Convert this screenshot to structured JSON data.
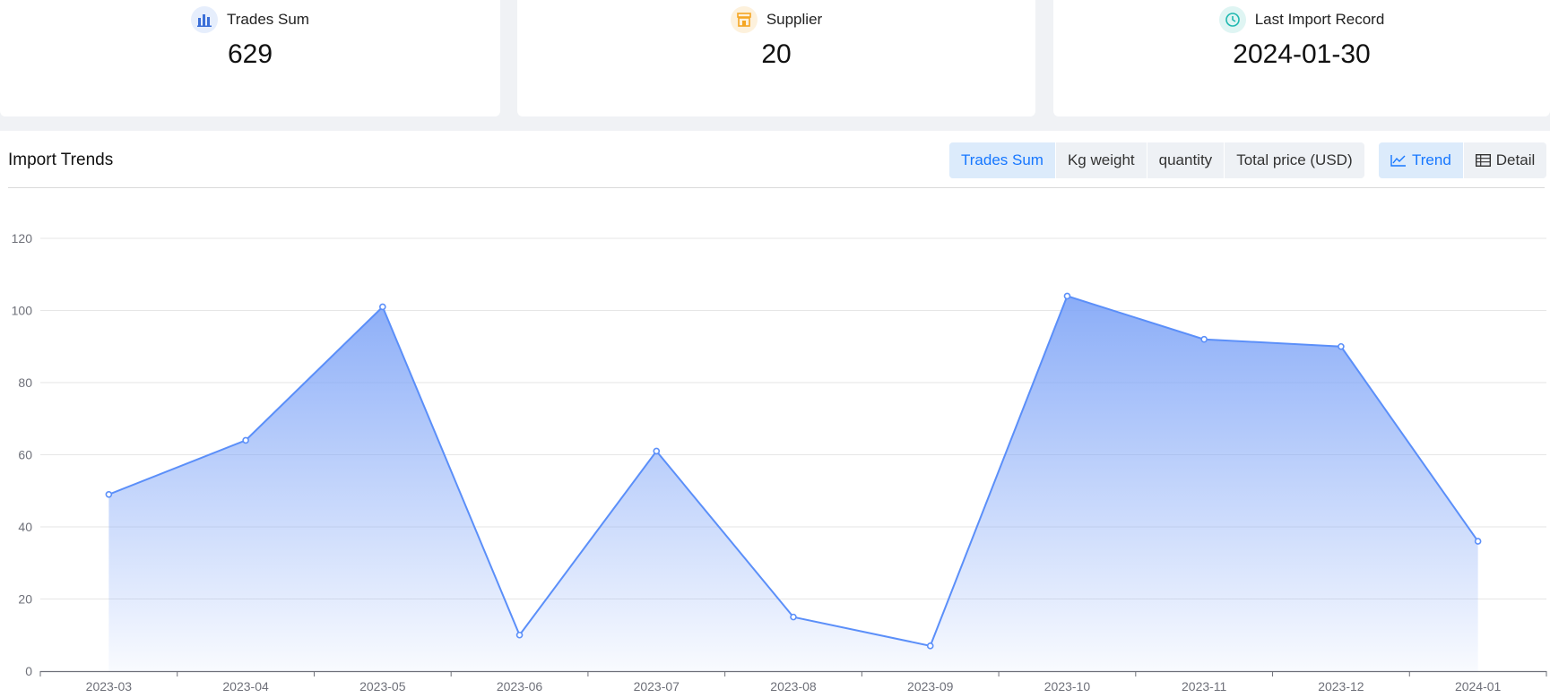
{
  "summary": {
    "trades": {
      "label": "Trades Sum",
      "value": "629",
      "icon": "bar-chart-icon",
      "color": "#3b6fd8"
    },
    "supplier": {
      "label": "Supplier",
      "value": "20",
      "icon": "store-icon",
      "color": "#f5a623"
    },
    "last_import": {
      "label": "Last Import Record",
      "value": "2024-01-30",
      "icon": "clock-icon",
      "color": "#1fb8b0"
    }
  },
  "panel": {
    "title": "Import Trends",
    "metric_tabs": [
      "Trades Sum",
      "Kg weight",
      "quantity",
      "Total price (USD)"
    ],
    "active_metric": "Trades Sum",
    "view_tabs": [
      {
        "label": "Trend",
        "icon": "line-chart-icon"
      },
      {
        "label": "Detail",
        "icon": "table-icon"
      }
    ],
    "active_view": "Trend"
  },
  "colors": {
    "accent": "#1677ff",
    "line": "#5b8ff9",
    "area_top": "#7ea4f7"
  },
  "chart_data": {
    "type": "area",
    "categories": [
      "2023-03",
      "2023-04",
      "2023-05",
      "2023-06",
      "2023-07",
      "2023-08",
      "2023-09",
      "2023-10",
      "2023-11",
      "2023-12",
      "2024-01"
    ],
    "values": [
      49,
      64,
      101,
      10,
      61,
      15,
      7,
      104,
      92,
      90,
      36
    ],
    "ylim": [
      0,
      120
    ],
    "yticks": [
      0,
      20,
      40,
      60,
      80,
      100,
      120
    ],
    "grid": true
  }
}
